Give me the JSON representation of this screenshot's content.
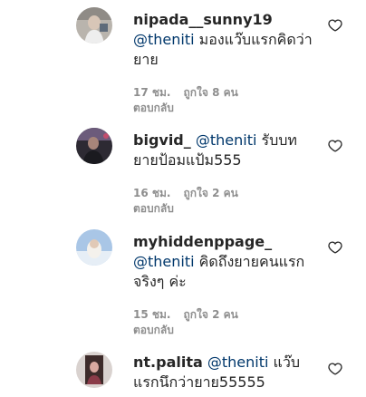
{
  "comments": [
    {
      "username": "nipada__sunny19",
      "mention": "@theniti",
      "text": "มองแว๊บแรกคิดว่ายาย",
      "time": "17 ชม.",
      "likes": "ถูกใจ 8 คน",
      "reply": "ตอบกลับ"
    },
    {
      "username": "bigvid_",
      "mention": "@theniti",
      "text": "รับบทยายป้อมแป้ม555",
      "time": "16 ชม.",
      "likes": "ถูกใจ 2 คน",
      "reply": "ตอบกลับ"
    },
    {
      "username": "myhiddenppage_",
      "mention": "@theniti",
      "text": "คิดถึงยายคนแรกจริงๆ ค่ะ",
      "time": "15 ชม.",
      "likes": "ถูกใจ 2 คน",
      "reply": "ตอบกลับ"
    },
    {
      "username": "nt.palita",
      "mention": "@theniti",
      "text": "แว๊บแรกนึกว่ายาย55555"
    }
  ],
  "icons": {
    "like": "heart-outline-icon"
  },
  "colors": {
    "mention": "#00376b",
    "meta": "#8e8e8e",
    "text": "#262626"
  }
}
